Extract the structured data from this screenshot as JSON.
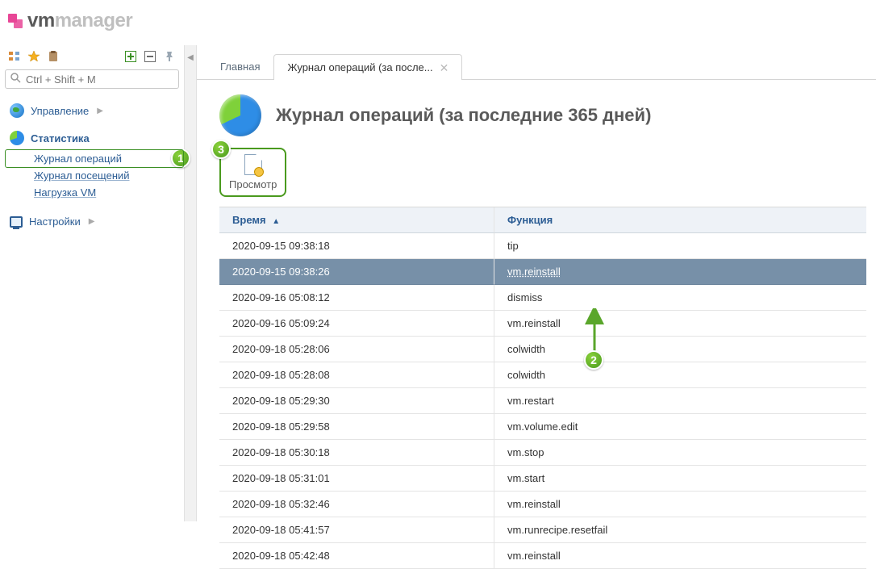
{
  "brand": {
    "vm": "vm",
    "manager": "manager"
  },
  "search": {
    "placeholder": "Ctrl + Shift + M"
  },
  "nav": {
    "management": {
      "label": "Управление"
    },
    "stats": {
      "label": "Статистика",
      "items": {
        "journal_ops": "Журнал операций",
        "journal_visits": "Журнал посещений",
        "load_vm": "Нагрузка VM"
      }
    },
    "settings": {
      "label": "Настройки"
    }
  },
  "tabs": {
    "main": "Главная",
    "journal": "Журнал операций (за после..."
  },
  "page": {
    "title": "Журнал операций (за последние 365 дней)",
    "toolbar": {
      "view": "Просмотр"
    }
  },
  "table": {
    "headers": {
      "time": "Время",
      "fn": "Функция"
    },
    "rows": [
      {
        "time": "2020-09-15 09:38:18",
        "fn": "tip"
      },
      {
        "time": "2020-09-15 09:38:26",
        "fn": "vm.reinstall",
        "selected": true
      },
      {
        "time": "2020-09-16 05:08:12",
        "fn": "dismiss"
      },
      {
        "time": "2020-09-16 05:09:24",
        "fn": "vm.reinstall"
      },
      {
        "time": "2020-09-18 05:28:06",
        "fn": "colwidth"
      },
      {
        "time": "2020-09-18 05:28:08",
        "fn": "colwidth"
      },
      {
        "time": "2020-09-18 05:29:30",
        "fn": "vm.restart"
      },
      {
        "time": "2020-09-18 05:29:58",
        "fn": "vm.volume.edit"
      },
      {
        "time": "2020-09-18 05:30:18",
        "fn": "vm.stop"
      },
      {
        "time": "2020-09-18 05:31:01",
        "fn": "vm.start"
      },
      {
        "time": "2020-09-18 05:32:46",
        "fn": "vm.reinstall"
      },
      {
        "time": "2020-09-18 05:41:57",
        "fn": "vm.runrecipe.resetfail"
      },
      {
        "time": "2020-09-18 05:42:48",
        "fn": "vm.reinstall"
      }
    ]
  },
  "steps": {
    "s1": "1",
    "s2": "2",
    "s3": "3"
  },
  "icons": {
    "tree": "tree-icon",
    "star": "star-icon",
    "clipboard": "clipboard-icon",
    "plus": "plus-icon",
    "minus": "minus-icon",
    "pin": "pin-icon",
    "search": "search-icon",
    "collapse": "collapse-icon"
  }
}
